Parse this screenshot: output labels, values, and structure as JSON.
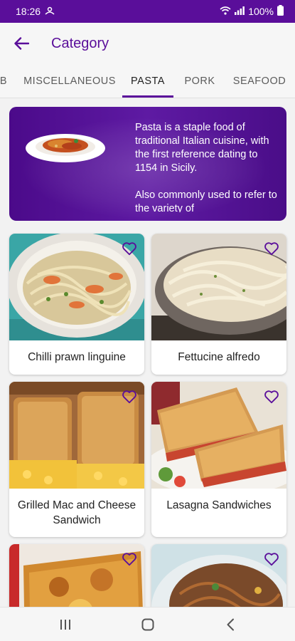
{
  "status_bar": {
    "time": "18:26",
    "battery": "100%",
    "icons": [
      "notification-icon",
      "wifi-icon",
      "signal-icon",
      "battery-icon"
    ]
  },
  "app_bar": {
    "title": "Category",
    "back_icon": "back-arrow-icon"
  },
  "tabs": {
    "items": [
      "B",
      "MISCELLANEOUS",
      "PASTA",
      "PORK",
      "SEAFOOD"
    ],
    "selected": "PASTA"
  },
  "banner": {
    "paragraphs": [
      "Pasta is a staple food of traditional Italian cuisine, with the first reference dating to 1154 in Sicily.",
      "Also commonly used to refer to the variety of"
    ]
  },
  "recipes": [
    {
      "name": "Chilli prawn linguine",
      "favorite_icon": "heart-outline-icon"
    },
    {
      "name": "Fettucine alfredo",
      "favorite_icon": "heart-outline-icon"
    },
    {
      "name": "Grilled Mac and Cheese Sandwich",
      "favorite_icon": "heart-outline-icon"
    },
    {
      "name": "Lasagna Sandwiches",
      "favorite_icon": "heart-outline-icon"
    },
    {
      "name": "",
      "favorite_icon": "heart-outline-icon"
    },
    {
      "name": "",
      "favorite_icon": "heart-outline-icon"
    }
  ],
  "nav_bar": {
    "icons": [
      "recent-apps-icon",
      "home-icon",
      "back-icon"
    ]
  },
  "colors": {
    "accent": "#5a0e9a",
    "status_bar": "#5a0e9a",
    "background": "#f2f2f2"
  }
}
